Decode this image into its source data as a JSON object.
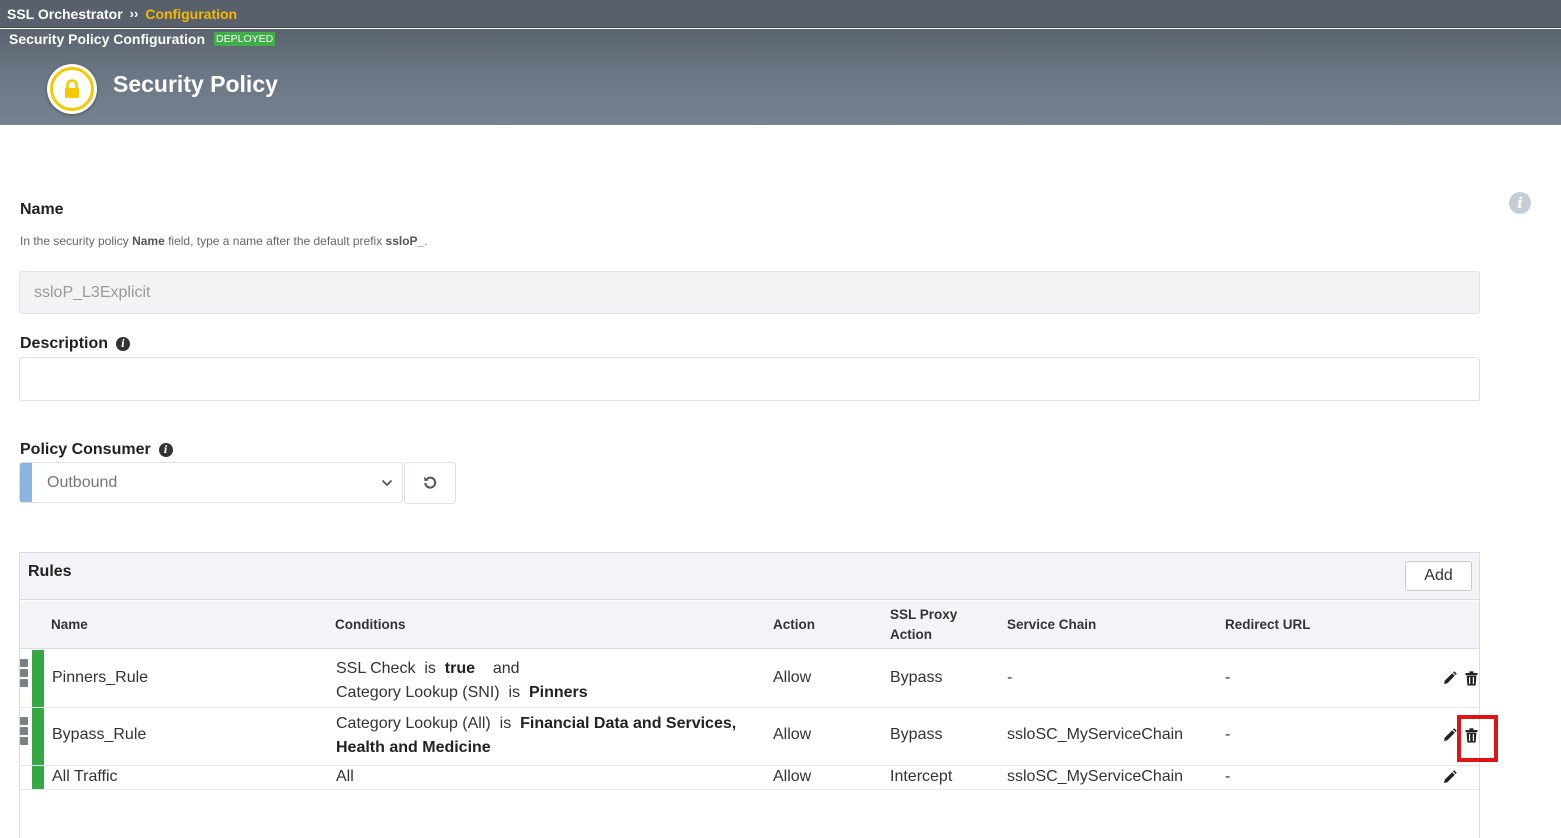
{
  "breadcrumb": {
    "root": "SSL Orchestrator",
    "separator": "››",
    "current": "Configuration"
  },
  "banner": {
    "subtitle": "Security Policy Configuration",
    "status_badge": "DEPLOYED",
    "title": "Security Policy"
  },
  "form": {
    "name_label": "Name",
    "name_hint_prefix": "In the security policy ",
    "name_hint_bold": "Name",
    "name_hint_mid": " field, type a name after the default prefix ",
    "name_hint_bold2": "ssloP_",
    "name_hint_end": ".",
    "name_value": "ssloP_L3Explicit",
    "description_label": "Description",
    "description_value": "",
    "consumer_label": "Policy Consumer",
    "consumer_value": "Outbound"
  },
  "rules": {
    "title": "Rules",
    "add_label": "Add",
    "columns": {
      "name": "Name",
      "conditions": "Conditions",
      "action": "Action",
      "ssl_proxy_action_1": "SSL Proxy",
      "ssl_proxy_action_2": "Action",
      "service_chain": "Service Chain",
      "redirect_url": "Redirect URL"
    },
    "rows": [
      {
        "name": "Pinners_Rule",
        "cond1_a": "SSL Check",
        "cond1_is": "is",
        "cond1_b": "true",
        "cond1_and": "and",
        "cond2_a": "Category Lookup (SNI)",
        "cond2_is": "is",
        "cond2_b": "Pinners",
        "action": "Allow",
        "ssl_action": "Bypass",
        "service_chain": "-",
        "redirect": "-"
      },
      {
        "name": "Bypass_Rule",
        "cond1_a": "Category Lookup (All)",
        "cond1_is": "is",
        "cond1_b": "Financial Data and Services,",
        "cond2_b": "Health and Medicine",
        "action": "Allow",
        "ssl_action": "Bypass",
        "service_chain": "ssloSC_MyServiceChain",
        "redirect": "-"
      },
      {
        "name": "All Traffic",
        "conditions": "All",
        "action": "Allow",
        "ssl_action": "Intercept",
        "service_chain": "ssloSC_MyServiceChain",
        "redirect": "-"
      }
    ]
  },
  "colors": {
    "header_bg": "#57606b",
    "breadcrumb_accent": "#f5b800",
    "deployed_badge": "#3fae49",
    "rule_enabled": "#35a845",
    "select_accent": "#8cb4e0",
    "highlight": "#e01414"
  }
}
